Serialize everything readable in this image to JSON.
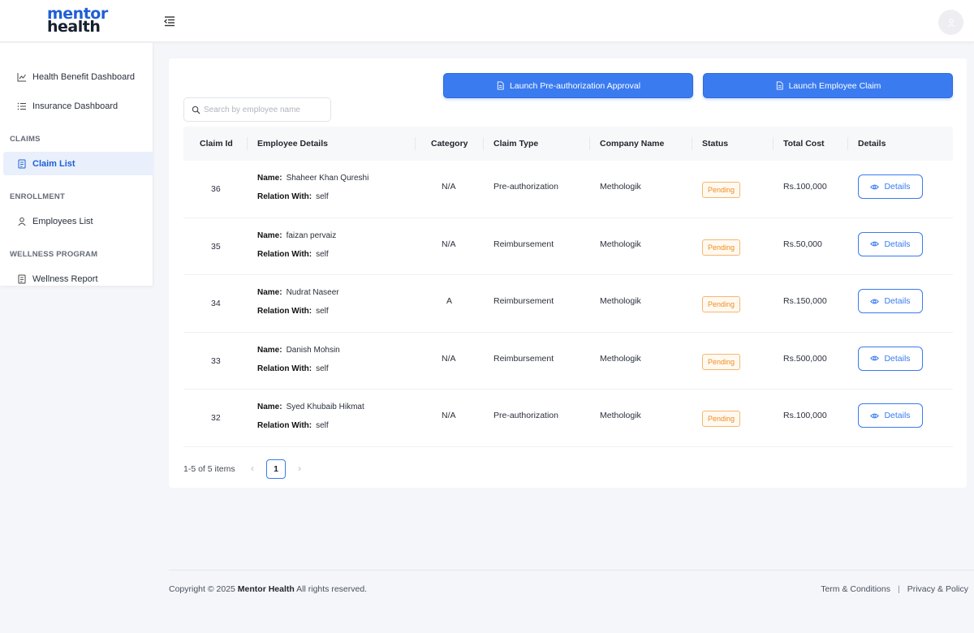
{
  "brand": {
    "line1": "mentor",
    "line2": "health"
  },
  "sidebar": {
    "items_top": [
      {
        "label": "Health Benefit Dashboard",
        "icon": "line-chart-icon"
      },
      {
        "label": "Insurance Dashboard",
        "icon": "list-icon"
      }
    ],
    "sections": [
      {
        "title": "CLAIMS",
        "items": [
          {
            "label": "Claim List",
            "icon": "document-icon",
            "active": true
          }
        ]
      },
      {
        "title": "ENROLLMENT",
        "items": [
          {
            "label": "Employees List",
            "icon": "user-icon"
          }
        ]
      },
      {
        "title": "WELLNESS PROGRAM",
        "items": [
          {
            "label": "Wellness Report",
            "icon": "document-icon"
          }
        ]
      }
    ]
  },
  "actions": {
    "preauth_label": "Launch Pre-authorization Approval",
    "claim_label": "Launch Employee Claim"
  },
  "search": {
    "placeholder": "Search by employee name",
    "value": ""
  },
  "table": {
    "headers": [
      "Claim Id",
      "Employee Details",
      "Category",
      "Claim Type",
      "Company Name",
      "Status",
      "Total Cost",
      "Details"
    ],
    "name_label": "Name:",
    "relation_label": "Relation With:",
    "details_label": "Details",
    "rows": [
      {
        "id": "36",
        "name": "Shaheer Khan Qureshi",
        "relation": "self",
        "category": "N/A",
        "claim_type": "Pre-authorization",
        "company": "Methologik",
        "status": "Pending",
        "cost": "Rs.100,000"
      },
      {
        "id": "35",
        "name": "faizan pervaiz",
        "relation": "self",
        "category": "N/A",
        "claim_type": "Reimbursement",
        "company": "Methologik",
        "status": "Pending",
        "cost": "Rs.50,000"
      },
      {
        "id": "34",
        "name": "Nudrat Naseer",
        "relation": "self",
        "category": "A",
        "claim_type": "Reimbursement",
        "company": "Methologik",
        "status": "Pending",
        "cost": "Rs.150,000"
      },
      {
        "id": "33",
        "name": "Danish Mohsin",
        "relation": "self",
        "category": "N/A",
        "claim_type": "Reimbursement",
        "company": "Methologik",
        "status": "Pending",
        "cost": "Rs.500,000"
      },
      {
        "id": "32",
        "name": "Syed Khubaib Hikmat",
        "relation": "self",
        "category": "N/A",
        "claim_type": "Pre-authorization",
        "company": "Methologik",
        "status": "Pending",
        "cost": "Rs.100,000"
      }
    ]
  },
  "pagination": {
    "summary": "1-5 of 5 items",
    "current_page": "1",
    "prev": "‹",
    "next": "›"
  },
  "footer": {
    "copyright_prefix": "Copyright © 2025",
    "brand": "Mentor Health",
    "copyright_suffix": "All rights reserved.",
    "terms": "Term & Conditions",
    "separator": "|",
    "privacy": "Privacy & Policy"
  },
  "colors": {
    "primary": "#3a7bf0",
    "brand_blue": "#1f5ed6",
    "pending": "#f08d1b"
  }
}
